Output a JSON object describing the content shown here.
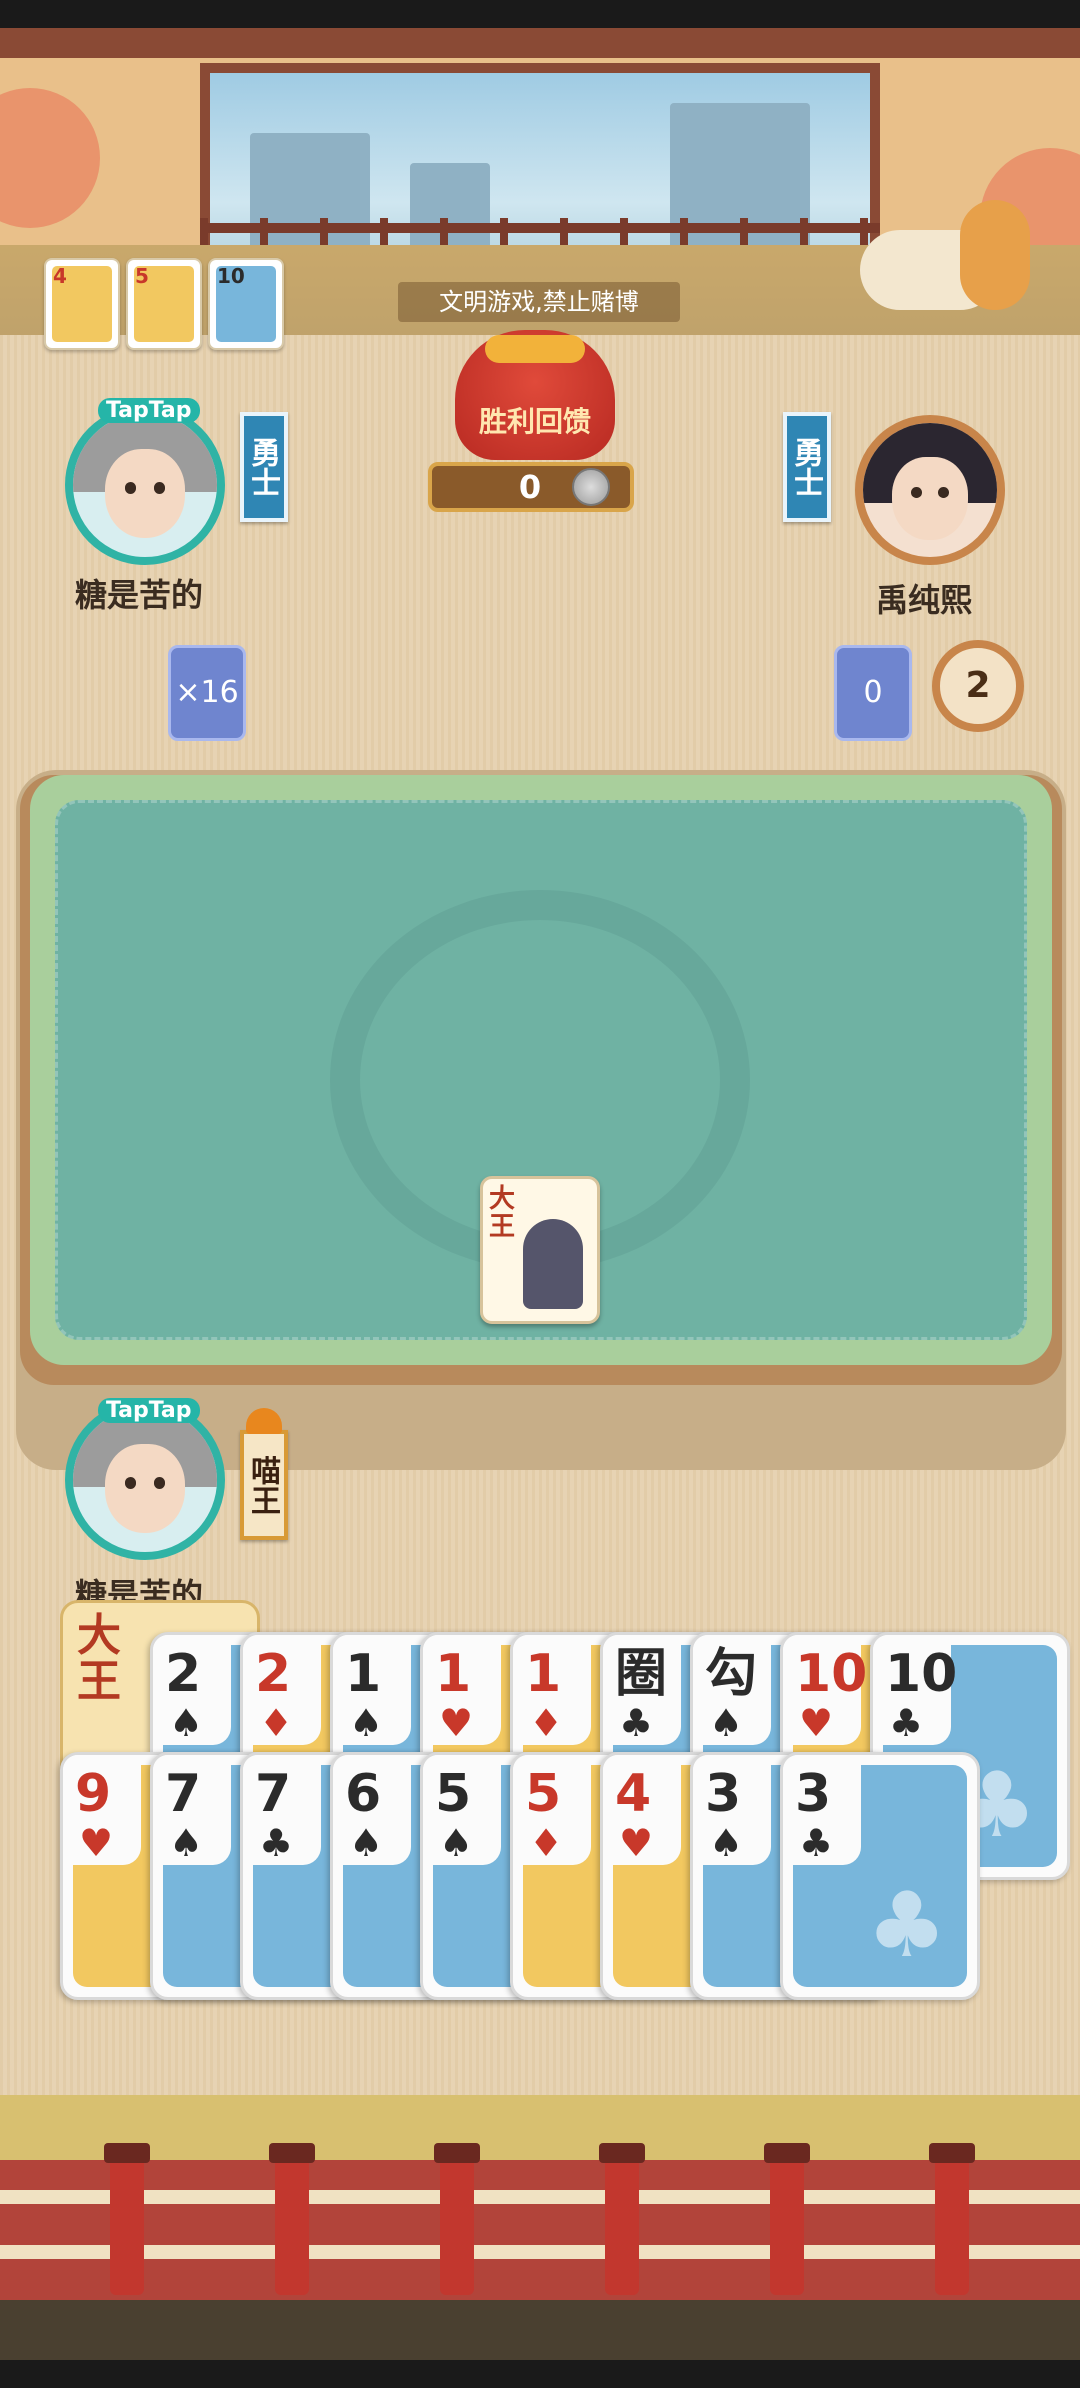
{
  "notice": "文明游戏,禁止赌博",
  "reward": {
    "title": "胜利回馈",
    "value": "0"
  },
  "top_cards": [
    {
      "rank": "4",
      "color": "red",
      "suit_icon": "heart-icon"
    },
    {
      "rank": "5",
      "color": "red",
      "suit_icon": "diamond-icon"
    },
    {
      "rank": "10",
      "color": "black",
      "suit_icon": "club-icon"
    }
  ],
  "players": {
    "left": {
      "name": "糖是苦的",
      "tag": "TapTap",
      "rank": "勇士",
      "card_count": "×16"
    },
    "right": {
      "name": "禹纯熙",
      "rank": "勇士",
      "card_count": "0",
      "timer": "2"
    },
    "self": {
      "name": "糖是苦的",
      "tag": "TapTap",
      "rank": "喵王"
    }
  },
  "played_card": {
    "label": "大王"
  },
  "hand": {
    "joker": {
      "label": "大王"
    },
    "row1": [
      {
        "rank": "2",
        "suit": "♠",
        "color": "black",
        "face": "blue"
      },
      {
        "rank": "2",
        "suit": "♦",
        "color": "red",
        "face": "yellow"
      },
      {
        "rank": "1",
        "suit": "♠",
        "color": "black",
        "face": "blue"
      },
      {
        "rank": "1",
        "suit": "♥",
        "color": "red",
        "face": "yellow"
      },
      {
        "rank": "1",
        "suit": "♦",
        "color": "red",
        "face": "yellow"
      },
      {
        "rank": "圈",
        "suit": "♣",
        "color": "black",
        "face": "blue"
      },
      {
        "rank": "勾",
        "suit": "♠",
        "color": "black",
        "face": "blue"
      },
      {
        "rank": "10",
        "suit": "♥",
        "color": "red",
        "face": "yellow"
      },
      {
        "rank": "10",
        "suit": "♣",
        "color": "black",
        "face": "blue"
      }
    ],
    "row2": [
      {
        "rank": "9",
        "suit": "♥",
        "color": "red",
        "face": "yellow"
      },
      {
        "rank": "7",
        "suit": "♠",
        "color": "black",
        "face": "blue"
      },
      {
        "rank": "7",
        "suit": "♣",
        "color": "black",
        "face": "blue"
      },
      {
        "rank": "6",
        "suit": "♠",
        "color": "black",
        "face": "blue"
      },
      {
        "rank": "5",
        "suit": "♠",
        "color": "black",
        "face": "blue"
      },
      {
        "rank": "5",
        "suit": "♦",
        "color": "red",
        "face": "yellow"
      },
      {
        "rank": "4",
        "suit": "♥",
        "color": "red",
        "face": "yellow"
      },
      {
        "rank": "3",
        "suit": "♠",
        "color": "black",
        "face": "blue"
      },
      {
        "rank": "3",
        "suit": "♣",
        "color": "black",
        "face": "blue"
      }
    ]
  },
  "colors": {
    "red": "#c8382a",
    "black": "#2b2b2b",
    "blue_face": "#78b6db",
    "yellow_face": "#f2c860",
    "felt": "#6fb2a3"
  }
}
